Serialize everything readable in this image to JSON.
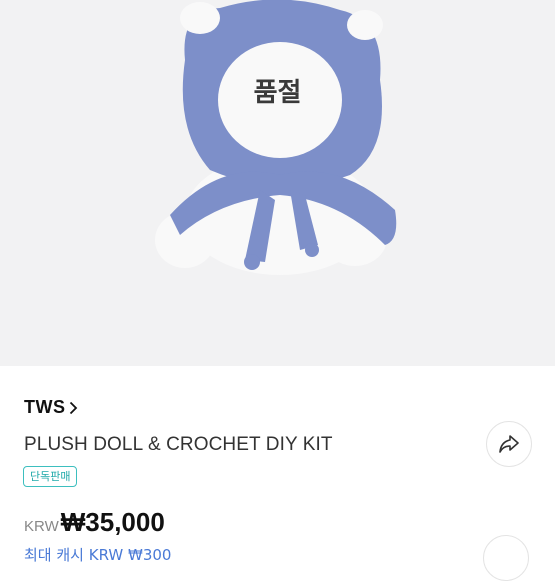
{
  "hero": {
    "status_overlay": "품절"
  },
  "product": {
    "brand": "TWS",
    "title": "PLUSH DOLL & CROCHET DIY KIT",
    "badge": "단독판매",
    "currency": "KRW",
    "price": "₩35,000",
    "points_text": "최대 캐시 KRW ₩300"
  },
  "icons": {
    "brand_chevron": "chevron-right-icon",
    "share": "share-icon"
  },
  "colors": {
    "badge": "#1fa9a9",
    "points": "#4a7ad6",
    "hero_bg": "#f2f2f3"
  }
}
